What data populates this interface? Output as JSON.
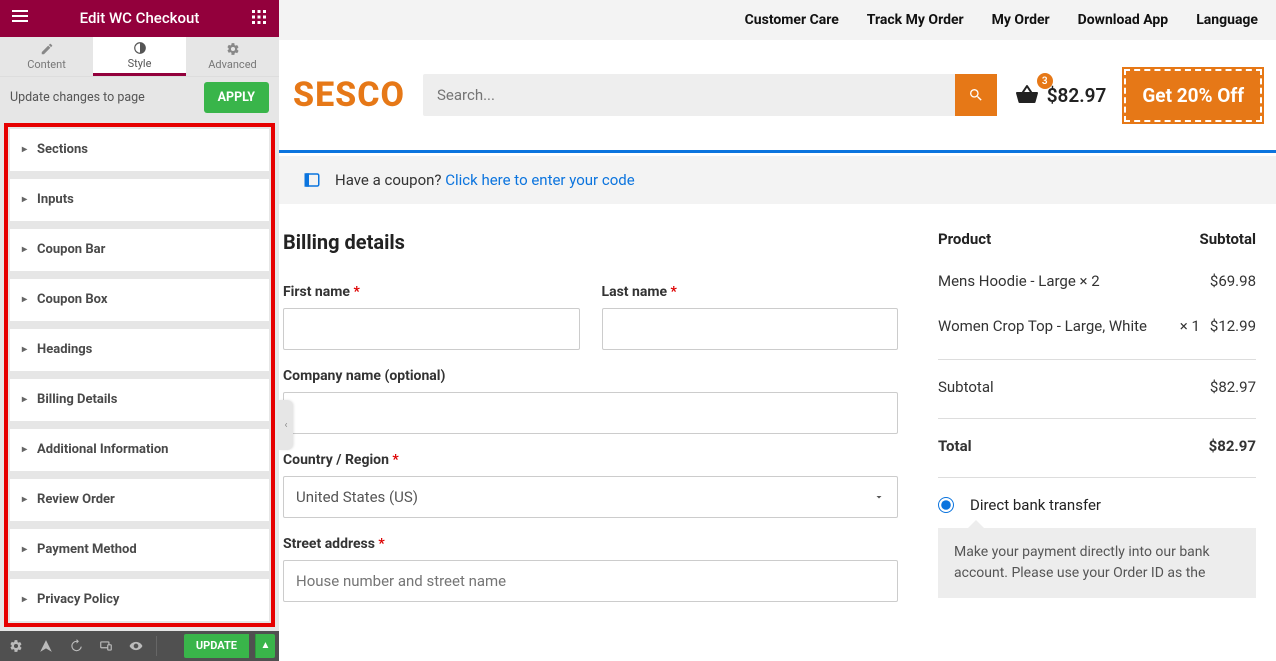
{
  "sidebar": {
    "title": "Edit WC Checkout",
    "tabs": {
      "content": "Content",
      "style": "Style",
      "advanced": "Advanced"
    },
    "apply_hint": "Update changes to page",
    "apply_btn": "APPLY",
    "panels": [
      "Sections",
      "Inputs",
      "Coupon Bar",
      "Coupon Box",
      "Headings",
      "Billing Details",
      "Additional Information",
      "Review Order",
      "Payment Method",
      "Privacy Policy"
    ],
    "update_btn": "UPDATE"
  },
  "topnav": [
    "Customer Care",
    "Track My Order",
    "My Order",
    "Download App",
    "Language"
  ],
  "logo": "SESCO",
  "search": {
    "placeholder": "Search..."
  },
  "cart": {
    "count": "3",
    "total": "$82.97"
  },
  "promo": "Get 20% Off",
  "coupon": {
    "prefix": "Have a coupon? ",
    "link": "Click here to enter your code"
  },
  "billing": {
    "title": "Billing details",
    "first_name": "First name",
    "last_name": "Last name",
    "company": "Company name (optional)",
    "country": "Country / Region",
    "country_value": "United States (US)",
    "street": "Street address",
    "street_ph": "House number and street name"
  },
  "order": {
    "head_product": "Product",
    "head_subtotal": "Subtotal",
    "items": [
      {
        "name": "Mens Hoodie - Large × 2",
        "qty": "",
        "price": "$69.98"
      },
      {
        "name": "Women Crop Top - Large, White",
        "qty": "× 1",
        "price": "$12.99"
      }
    ],
    "subtotal_label": "Subtotal",
    "subtotal": "$82.97",
    "total_label": "Total",
    "total": "$82.97"
  },
  "payment": {
    "opt1": "Direct bank transfer",
    "desc": "Make your payment directly into our bank account. Please use your Order ID as the"
  }
}
